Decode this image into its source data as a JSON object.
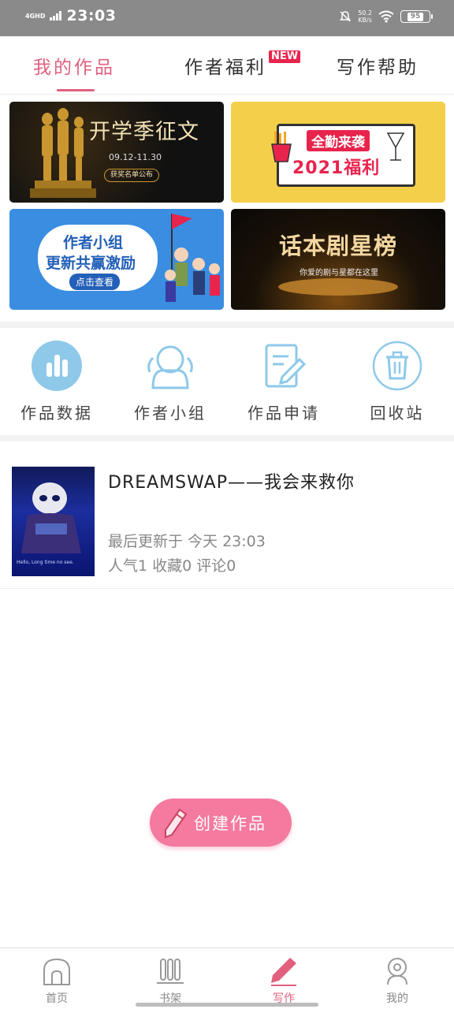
{
  "status_bar": {
    "network": "4GHD",
    "time": "23:03",
    "speed_value": "50.2",
    "speed_unit": "KB/s",
    "battery": "95",
    "icons": [
      "signal-icon",
      "mute-bell-icon",
      "wifi-icon",
      "battery-icon"
    ]
  },
  "tabs": [
    {
      "label": "我的作品",
      "active": true
    },
    {
      "label": "作者福利",
      "badge": "NEW"
    },
    {
      "label": "写作帮助"
    }
  ],
  "banners": [
    {
      "title": "开学季征文",
      "date": "09.12-11.30",
      "button": "获奖名单公布"
    },
    {
      "line1": "全勤来袭",
      "line2": "2021福利"
    },
    {
      "line1": "作者小组",
      "line2": "更新共赢激励",
      "button": "点击查看"
    },
    {
      "title": "话本剧星榜",
      "subtitle": "你爱的剧与星都在这里"
    }
  ],
  "quick_actions": [
    {
      "label": "作品数据",
      "icon": "bar-chart-icon"
    },
    {
      "label": "作者小组",
      "icon": "group-person-icon"
    },
    {
      "label": "作品申请",
      "icon": "edit-document-icon"
    },
    {
      "label": "回收站",
      "icon": "trash-icon"
    }
  ],
  "works": [
    {
      "title": "DREAMSWAP——我会来救你",
      "last_update": "最后更新于 今天 23:03",
      "stats": "人气1 收藏0 评论0",
      "cover_caption": "Hello, Long time no see."
    }
  ],
  "create_button": {
    "label": "创建作品",
    "icon": "pencil-icon"
  },
  "bottom_nav": [
    {
      "label": "首页",
      "icon": "home-icon"
    },
    {
      "label": "书架",
      "icon": "bookshelf-icon"
    },
    {
      "label": "写作",
      "icon": "write-pen-icon",
      "active": true
    },
    {
      "label": "我的",
      "icon": "profile-icon"
    }
  ],
  "colors": {
    "accent": "#e0607e",
    "create_button": "#f47aa0",
    "quick_icon": "#8ec9ea",
    "status_bar": "#8a8a8a"
  }
}
